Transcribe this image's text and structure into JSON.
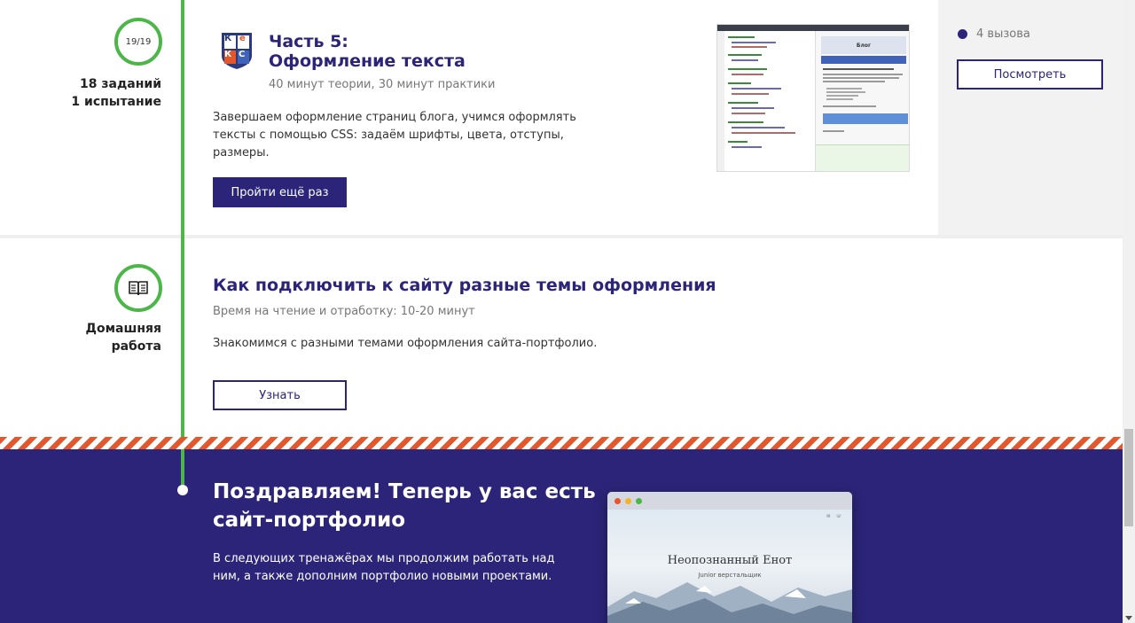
{
  "section1": {
    "progress_label": "19/19",
    "tasks_label": "18 заданий",
    "challenge_label": "1 испытание",
    "title_line1": "Часть 5:",
    "title_line2": "Оформление текста",
    "meta": "40 минут теории, 30 минут практики",
    "description": "Завершаем оформление страниц блога, учимся оформлять тексты с помощью CSS: задаём шрифты, цвета, отступы, размеры.",
    "repeat_button": "Пройти ещё раз",
    "logo_letters": [
      "К",
      "е",
      "К",
      "С"
    ],
    "thumbnail": {
      "blog_heading": "Блог"
    }
  },
  "sidebar": {
    "calls": "4 вызова",
    "view_button": "Посмотреть",
    "accent_color": "#2b2478"
  },
  "section2": {
    "icon": "book-icon",
    "label_line1": "Домашняя",
    "label_line2": "работа",
    "title": "Как подключить к сайту разные темы оформления",
    "meta": "Время на чтение и отработку: 10-20 минут",
    "description": "Знакомимся с разными темами оформления сайта-портфолио.",
    "learn_button": "Узнать"
  },
  "banner": {
    "title": "Поздравляем! Теперь у вас есть сайт-портфолио",
    "text": "В следующих тренажёрах мы продолжим работать над ним, а также дополним портфолио новыми проектами.",
    "preview": {
      "site_title": "Неопознанный Енот",
      "site_subtitle": "Junior верстальщик"
    }
  },
  "colors": {
    "timeline": "#4cb748",
    "primary": "#2b2478",
    "stripe": "#e2582c"
  }
}
